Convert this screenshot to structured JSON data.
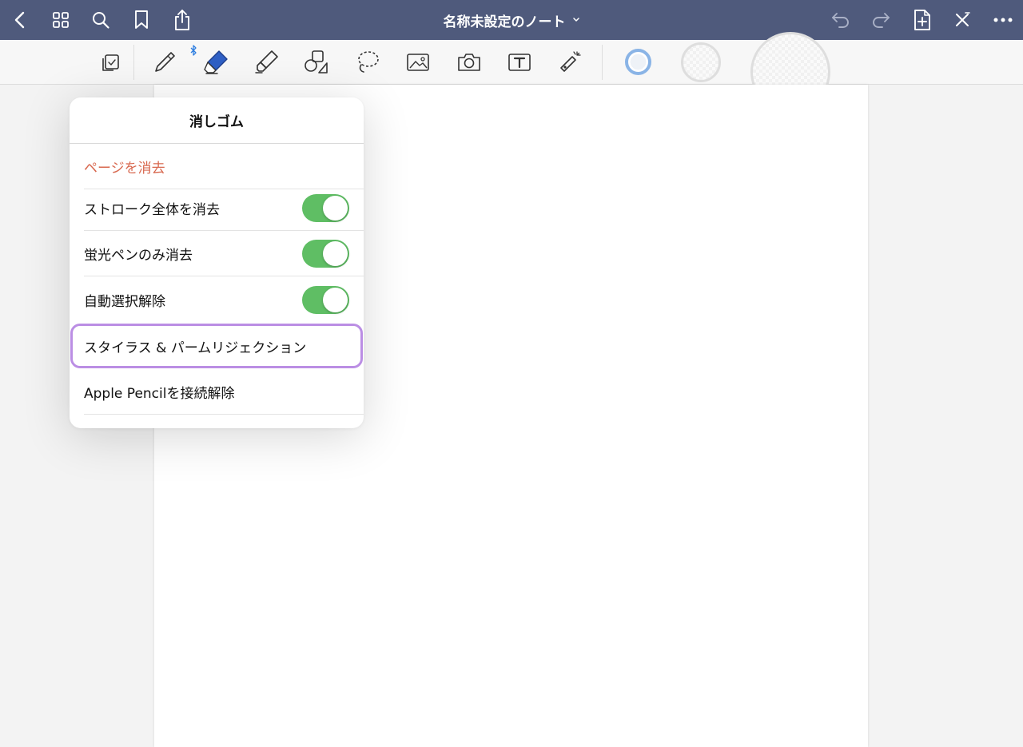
{
  "header": {
    "title": "名称未設定のノート",
    "icons": {
      "back": "chevron-left-icon",
      "grid": "grid-icon",
      "search": "search-icon",
      "bookmark": "bookmark-icon",
      "share": "share-icon",
      "title_dropdown": "chevron-down-icon",
      "undo": "undo-icon",
      "redo": "redo-icon",
      "add_page": "add-page-icon",
      "close_toolbar": "close-toolbar-icon",
      "more": "ellipsis-icon"
    }
  },
  "toolbar": {
    "tools": [
      "read-mode",
      "pen",
      "eraser",
      "highlighter",
      "shapes",
      "lasso",
      "image",
      "camera",
      "text",
      "laser-pointer"
    ],
    "selected_tool": "eraser",
    "bluetooth_connected": true,
    "swatches": [
      "eraser-size-small",
      "eraser-size-medium",
      "eraser-size-large"
    ],
    "selected_swatch": "eraser-size-small"
  },
  "eraser_popover": {
    "title": "消しゴム",
    "erase_page": "ページを消去",
    "options": [
      {
        "label": "ストローク全体を消去",
        "enabled": true
      },
      {
        "label": "蛍光ペンのみ消去",
        "enabled": true
      },
      {
        "label": "自動選択解除",
        "enabled": true
      }
    ],
    "stylus_palm": "スタイラス & パームリジェクション",
    "disconnect_pencil": "Apple Pencilを接続解除"
  },
  "colors": {
    "nav_bar": "#4f5a7c",
    "accent_eraser": "#2f5fc4",
    "toggle_on": "#5fbe64",
    "danger_text": "#d8684f",
    "highlight_outline": "#bb8ee4",
    "selected_swatch_ring": "#8ab4e6"
  }
}
